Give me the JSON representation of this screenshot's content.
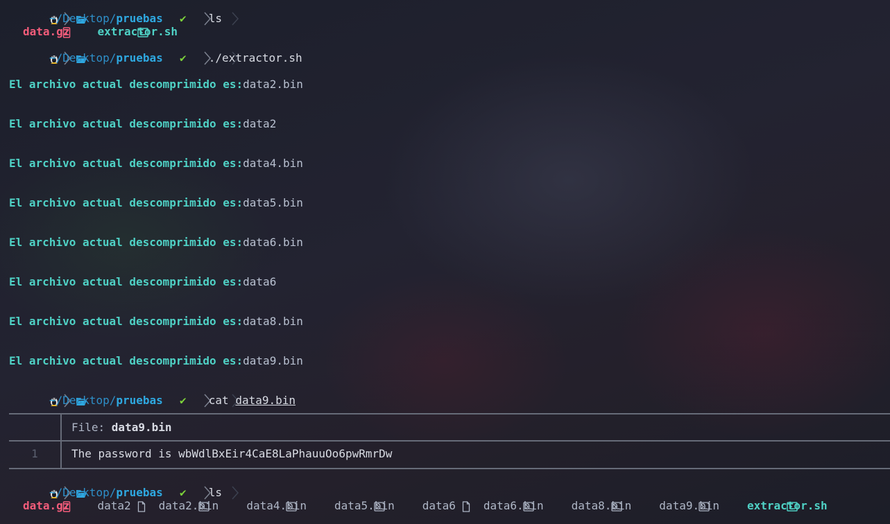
{
  "prompt": {
    "path_home": "~",
    "path_mid": "/Desktop/",
    "path_last": "pruebas"
  },
  "session": {
    "cmd1": "ls",
    "ls1_files": [
      {
        "name": "data.gz",
        "kind": "gz"
      },
      {
        "name": "extractor.sh",
        "kind": "sh"
      }
    ],
    "cmd2": "./extractor.sh",
    "extract_label": "El archivo actual descomprimido es:",
    "extracted": [
      "data2.bin",
      "data2",
      "data4.bin",
      "data5.bin",
      "data6.bin",
      "data6",
      "data8.bin",
      "data9.bin"
    ],
    "cmd3_name": "cat",
    "cmd3_arg": "data9.bin",
    "cat": {
      "header_label": "File: ",
      "header_file": "data9.bin",
      "line_number": "1",
      "content": "The password is wbWdlBxEir4CaE8LaPhauuOo6pwRmrDw"
    },
    "cmd4": "ls",
    "ls2_files": [
      {
        "name": "data.gz",
        "kind": "gz"
      },
      {
        "name": "data2",
        "kind": "plain"
      },
      {
        "name": "data2.bin",
        "kind": "bin"
      },
      {
        "name": "data4.bin",
        "kind": "bin"
      },
      {
        "name": "data5.bin",
        "kind": "bin"
      },
      {
        "name": "data6",
        "kind": "plain"
      },
      {
        "name": "data6.bin",
        "kind": "bin"
      },
      {
        "name": "data8.bin",
        "kind": "bin"
      },
      {
        "name": "data9.bin",
        "kind": "bin"
      },
      {
        "name": "extractor.sh",
        "kind": "sh"
      }
    ]
  },
  "colors": {
    "background": "#1a1d27",
    "accent_blue": "#2ea8e0",
    "check_green": "#7cd13a",
    "teal": "#4fd1c5",
    "pink": "#f25c7a"
  },
  "icons": {
    "os": "linux-tux-icon",
    "folder": "folder-open-icon",
    "status": "checkmark-icon",
    "archive": "archive-zip-icon",
    "script": "terminal-script-icon",
    "binary": "binary-file-icon",
    "file": "file-icon"
  }
}
